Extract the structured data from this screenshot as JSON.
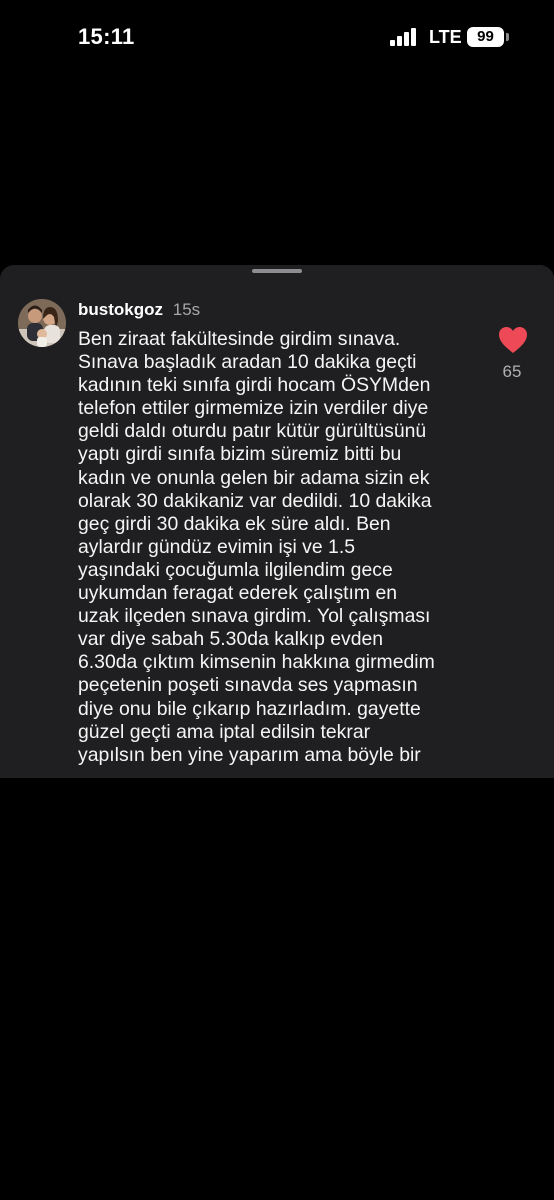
{
  "status_bar": {
    "time": "15:11",
    "network": "LTE",
    "battery": "99"
  },
  "comment": {
    "username": "bustokgoz",
    "timestamp": "15s",
    "text": "Ben ziraat fakültesinde girdim sınava.\nSınava başladık aradan 10 dakika geçti\nkadının teki sınıfa girdi hocam ÖSYMden\ntelefon ettiler girmemize izin verdiler diye\ngeldi daldı oturdu patır kütür gürültüsünü\nyaptı girdi sınıfa bizim süremiz bitti bu\nkadın ve onunla gelen bir adama sizin ek\nolarak 30 dakikaniz var dedildi. 10 dakika\ngeç girdi 30 dakika ek süre aldı. Ben\naylardır gündüz evimin işi ve 1.5\nyaşındaki çocuğumla ilgilendim gece\nuykumdan feragat ederek çalıştım en\nuzak ilçeden sınava girdim. Yol çalışması\nvar diye sabah 5.30da kalkıp evden\n6.30da çıktım kimsenin hakkına girmedim\npeçetenin poşeti sınavda ses yapmasın\ndiye onu bile çıkarıp hazırladım. gayette\ngüzel geçti ama iptal edilsin tekrar\nyapılsın ben yine yaparım ama böyle bir",
    "like_count": "65",
    "liked": true,
    "heart_color": "#ed4956"
  },
  "colors": {
    "background": "#000000",
    "sheet": "#1f1f21",
    "secondary_text": "#a8a8a8"
  }
}
